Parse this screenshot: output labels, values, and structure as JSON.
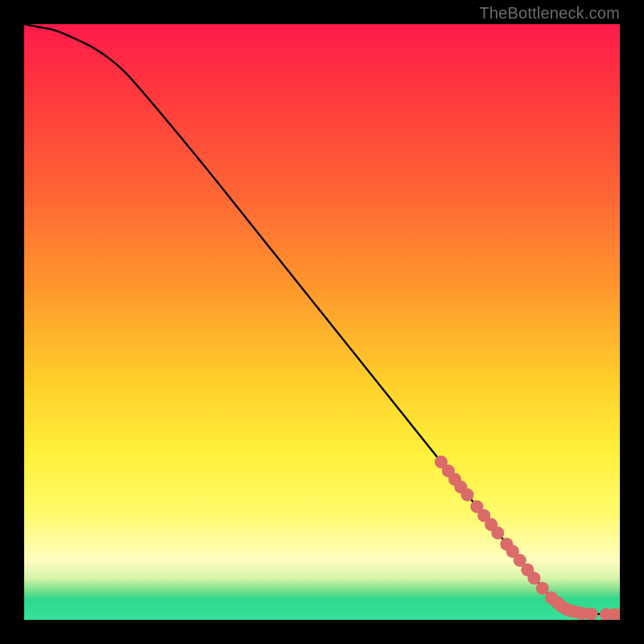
{
  "watermark": "TheBottleneck.com",
  "chart_data": {
    "type": "line",
    "title": "",
    "xlabel": "",
    "ylabel": "",
    "xlim": [
      0,
      100
    ],
    "ylim": [
      0,
      100
    ],
    "grid": false,
    "series": [
      {
        "name": "curve",
        "x": [
          0,
          2,
          5,
          8,
          12,
          16,
          20,
          30,
          40,
          50,
          60,
          70,
          78,
          82,
          85,
          88,
          90,
          92,
          94,
          96,
          98,
          100
        ],
        "y": [
          100,
          99.6,
          99.0,
          97.8,
          95.8,
          92.8,
          88.5,
          76.5,
          64.0,
          51.5,
          39.0,
          26.5,
          16.5,
          11.5,
          7.8,
          4.3,
          2.5,
          1.6,
          1.2,
          1.0,
          0.9,
          0.9
        ]
      }
    ],
    "markers": [
      {
        "x": 70.0,
        "y": 26.5
      },
      {
        "x": 71.2,
        "y": 25.0
      },
      {
        "x": 72.3,
        "y": 23.6
      },
      {
        "x": 73.3,
        "y": 22.3
      },
      {
        "x": 74.4,
        "y": 21.0
      },
      {
        "x": 76.0,
        "y": 19.0
      },
      {
        "x": 77.2,
        "y": 17.5
      },
      {
        "x": 78.4,
        "y": 16.0
      },
      {
        "x": 79.5,
        "y": 14.6
      },
      {
        "x": 81.0,
        "y": 12.7
      },
      {
        "x": 82.0,
        "y": 11.5
      },
      {
        "x": 83.2,
        "y": 10.0
      },
      {
        "x": 84.5,
        "y": 8.4
      },
      {
        "x": 85.6,
        "y": 7.0
      },
      {
        "x": 87.0,
        "y": 5.3
      },
      {
        "x": 88.5,
        "y": 3.7
      },
      {
        "x": 89.5,
        "y": 2.9
      },
      {
        "x": 90.2,
        "y": 2.3
      },
      {
        "x": 91.0,
        "y": 1.8
      },
      {
        "x": 91.8,
        "y": 1.5
      },
      {
        "x": 92.7,
        "y": 1.3
      },
      {
        "x": 93.7,
        "y": 1.1
      },
      {
        "x": 95.2,
        "y": 1.0
      },
      {
        "x": 97.7,
        "y": 0.9
      },
      {
        "x": 99.2,
        "y": 0.9
      }
    ],
    "marker_color": "#db6b69",
    "curve_color": "#000000",
    "background": "heat-gradient"
  }
}
